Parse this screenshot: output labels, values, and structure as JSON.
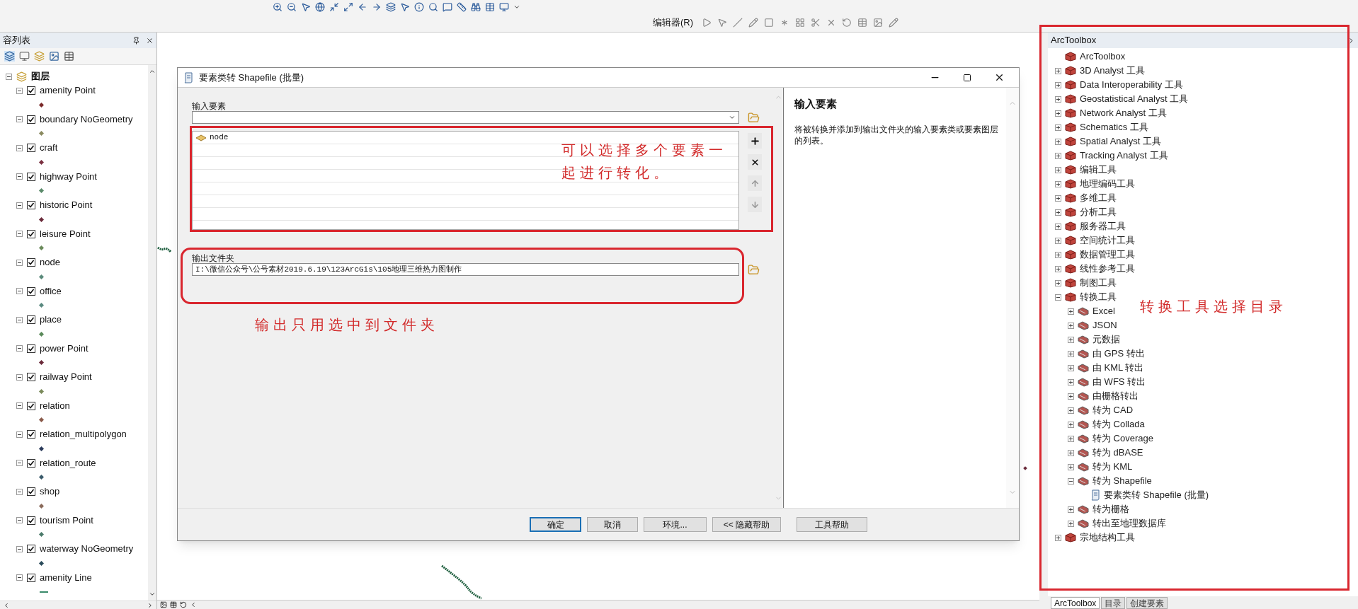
{
  "toolbar": {
    "editor_menu": "编辑器(R)"
  },
  "contents_panel": {
    "title": "容列表",
    "root": "图层",
    "layers": [
      {
        "name": "amenity Point",
        "checked": true,
        "expanded": true,
        "kind": "point",
        "color": "#7a2a2a"
      },
      {
        "name": "boundary NoGeometry",
        "checked": true,
        "expanded": true,
        "kind": "point",
        "color": "#8a8a60"
      },
      {
        "name": "craft",
        "checked": true,
        "expanded": true,
        "kind": "point",
        "color": "#7a3040"
      },
      {
        "name": "highway Point",
        "checked": true,
        "expanded": true,
        "kind": "point",
        "color": "#5a8a6a"
      },
      {
        "name": "historic Point",
        "checked": true,
        "expanded": true,
        "kind": "point",
        "color": "#6a2a3a"
      },
      {
        "name": "leisure Point",
        "checked": true,
        "expanded": true,
        "kind": "point",
        "color": "#6a8a5a"
      },
      {
        "name": "node",
        "checked": true,
        "expanded": true,
        "kind": "point",
        "color": "#5a8a7a"
      },
      {
        "name": "office",
        "checked": true,
        "expanded": true,
        "kind": "point",
        "color": "#5a8a80"
      },
      {
        "name": "place",
        "checked": true,
        "expanded": true,
        "kind": "point",
        "color": "#5a8a5a"
      },
      {
        "name": "power Point",
        "checked": true,
        "expanded": true,
        "kind": "point",
        "color": "#6a2a3a"
      },
      {
        "name": "railway Point",
        "checked": true,
        "expanded": true,
        "kind": "point",
        "color": "#7a8a5a"
      },
      {
        "name": "relation",
        "checked": true,
        "expanded": true,
        "kind": "point",
        "color": "#8a5a4a"
      },
      {
        "name": "relation_multipolygon",
        "checked": true,
        "expanded": true,
        "kind": "point",
        "color": "#2a3a5a"
      },
      {
        "name": "relation_route",
        "checked": true,
        "expanded": true,
        "kind": "point",
        "color": "#3a5a6a"
      },
      {
        "name": "shop",
        "checked": true,
        "expanded": true,
        "kind": "point",
        "color": "#8a6a5a"
      },
      {
        "name": "tourism Point",
        "checked": true,
        "expanded": true,
        "kind": "point",
        "color": "#4a7a6a"
      },
      {
        "name": "waterway NoGeometry",
        "checked": true,
        "expanded": true,
        "kind": "point",
        "color": "#2a4a5a"
      },
      {
        "name": "amenity Line",
        "checked": true,
        "expanded": true,
        "kind": "line",
        "color": "#3a8a6a"
      }
    ]
  },
  "dialog": {
    "title": "要素类转 Shapefile (批量)",
    "input_label": "输入要素",
    "input_items": [
      "node"
    ],
    "output_label": "输出文件夹",
    "output_value": "I:\\微信公众号\\公号素材2019.6.19\\123ArcGis\\105地理三维热力图制作",
    "help_title": "输入要素",
    "help_text": "将被转换并添加到输出文件夹的输入要素类或要素图层的列表。",
    "buttons": [
      {
        "label": "确定",
        "default": true
      },
      {
        "label": "取消",
        "default": false
      },
      {
        "label": "环境...",
        "default": false
      },
      {
        "label": "<< 隐藏帮助",
        "default": false
      }
    ],
    "help_button": "工具帮助"
  },
  "annotations": [
    {
      "text": "可以选择多个要素一起进行转化。"
    },
    {
      "text": "输出只用选中到文件夹"
    },
    {
      "text": "转换工具选择目录"
    }
  ],
  "toolbox_panel": {
    "title": "ArcToolbox",
    "tree": {
      "label": "ArcToolbox",
      "kind": "root",
      "children": [
        {
          "label": "3D Analyst 工具",
          "kind": "toolbox",
          "expanded": false
        },
        {
          "label": "Data Interoperability 工具",
          "kind": "toolbox",
          "expanded": false
        },
        {
          "label": "Geostatistical Analyst 工具",
          "kind": "toolbox",
          "expanded": false
        },
        {
          "label": "Network Analyst 工具",
          "kind": "toolbox",
          "expanded": false
        },
        {
          "label": "Schematics 工具",
          "kind": "toolbox",
          "expanded": false
        },
        {
          "label": "Spatial Analyst 工具",
          "kind": "toolbox",
          "expanded": false
        },
        {
          "label": "Tracking Analyst 工具",
          "kind": "toolbox",
          "expanded": false
        },
        {
          "label": "编辑工具",
          "kind": "toolbox",
          "expanded": false
        },
        {
          "label": "地理编码工具",
          "kind": "toolbox",
          "expanded": false
        },
        {
          "label": "多维工具",
          "kind": "toolbox",
          "expanded": false
        },
        {
          "label": "分析工具",
          "kind": "toolbox",
          "expanded": false
        },
        {
          "label": "服务器工具",
          "kind": "toolbox",
          "expanded": false
        },
        {
          "label": "空间统计工具",
          "kind": "toolbox",
          "expanded": false
        },
        {
          "label": "数据管理工具",
          "kind": "toolbox",
          "expanded": false
        },
        {
          "label": "线性参考工具",
          "kind": "toolbox",
          "expanded": false
        },
        {
          "label": "制图工具",
          "kind": "toolbox",
          "expanded": false
        },
        {
          "label": "转换工具",
          "kind": "toolbox",
          "expanded": true,
          "children": [
            {
              "label": "Excel",
              "kind": "toolset",
              "expanded": false
            },
            {
              "label": "JSON",
              "kind": "toolset",
              "expanded": false
            },
            {
              "label": "元数据",
              "kind": "toolset",
              "expanded": false
            },
            {
              "label": "由 GPS 转出",
              "kind": "toolset",
              "expanded": false
            },
            {
              "label": "由 KML 转出",
              "kind": "toolset",
              "expanded": false
            },
            {
              "label": "由 WFS 转出",
              "kind": "toolset",
              "expanded": false
            },
            {
              "label": "由栅格转出",
              "kind": "toolset",
              "expanded": false
            },
            {
              "label": "转为 CAD",
              "kind": "toolset",
              "expanded": false
            },
            {
              "label": "转为 Collada",
              "kind": "toolset",
              "expanded": false
            },
            {
              "label": "转为 Coverage",
              "kind": "toolset",
              "expanded": false
            },
            {
              "label": "转为 dBASE",
              "kind": "toolset",
              "expanded": false
            },
            {
              "label": "转为 KML",
              "kind": "toolset",
              "expanded": false
            },
            {
              "label": "转为 Shapefile",
              "kind": "toolset",
              "expanded": true,
              "children": [
                {
                  "label": "要素类转 Shapefile (批量)",
                  "kind": "tool"
                }
              ]
            },
            {
              "label": "转为栅格",
              "kind": "toolset",
              "expanded": false
            },
            {
              "label": "转出至地理数据库",
              "kind": "toolset",
              "expanded": false
            }
          ]
        },
        {
          "label": "宗地结构工具",
          "kind": "toolbox",
          "expanded": false
        }
      ]
    },
    "tabs": [
      {
        "label": "ArcToolbox",
        "selected": true
      },
      {
        "label": "目录",
        "selected": false
      },
      {
        "label": "创建要素",
        "selected": false
      }
    ]
  }
}
